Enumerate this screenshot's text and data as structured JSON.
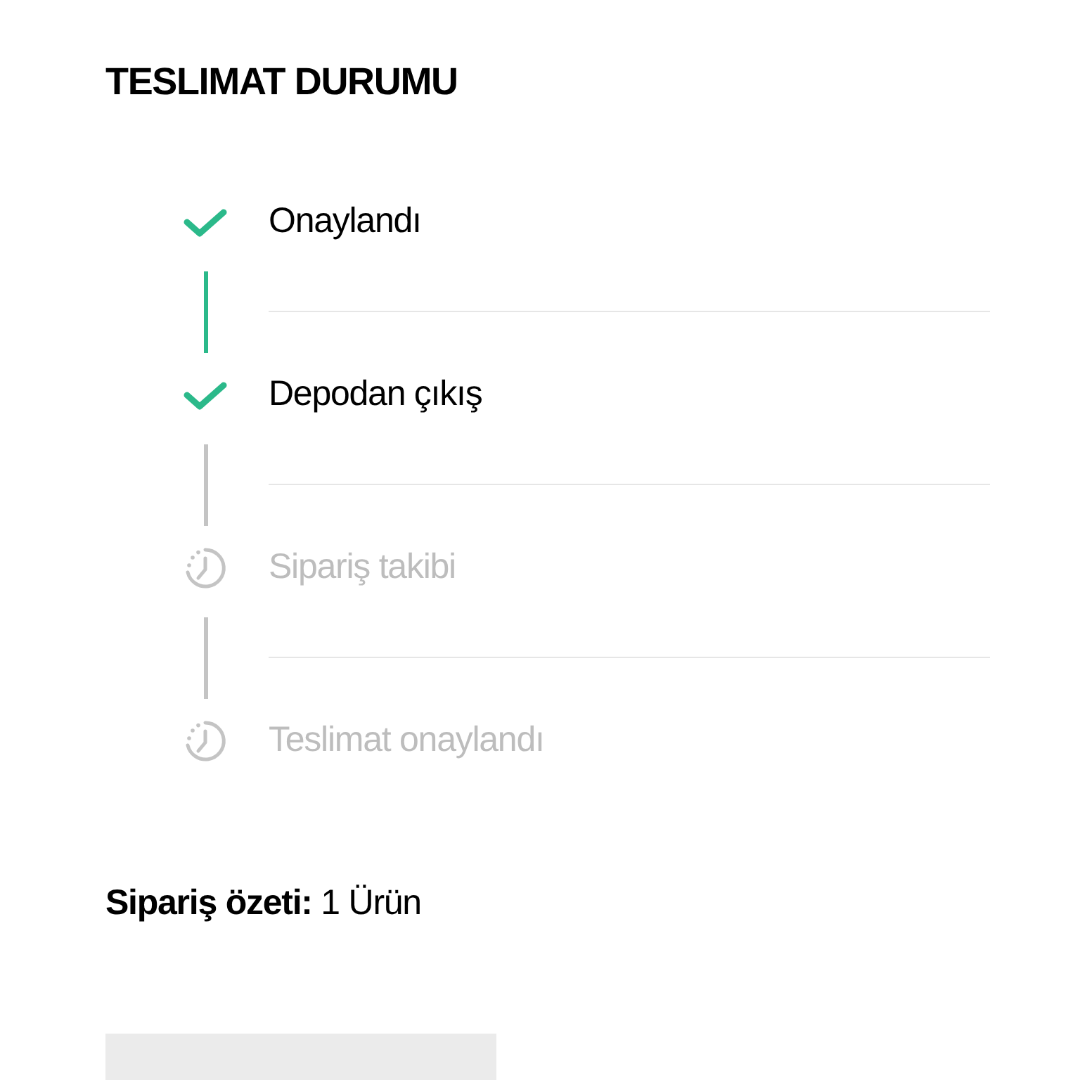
{
  "title": "TESLIMAT DURUMU",
  "steps": [
    {
      "label": "Onaylandı",
      "done": true
    },
    {
      "label": "Depodan çıkış",
      "done": true
    },
    {
      "label": "Sipariş takibi",
      "done": false
    },
    {
      "label": "Teslimat onaylandı",
      "done": false
    }
  ],
  "summary": "**Sipariş özeti:** 1 Ürün"
}
